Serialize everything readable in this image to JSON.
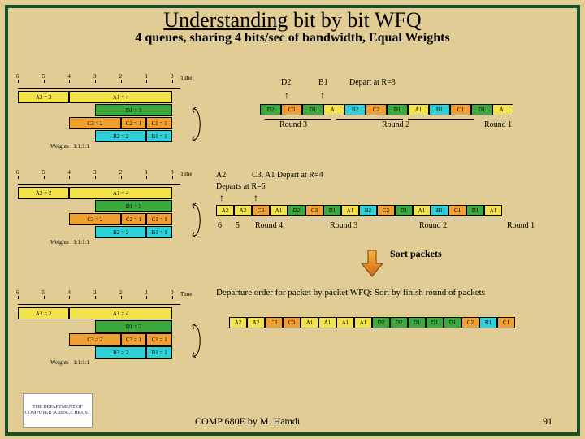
{
  "title_prefix": "Understanding",
  "title_rest": " bit by bit WFQ",
  "subtitle": "4 queues, sharing 4 bits/sec of bandwidth, Equal Weights",
  "time": "Time",
  "ticks": [
    "6",
    "5",
    "4",
    "3",
    "2",
    "1",
    "0"
  ],
  "pkt": {
    "A2": "A2 = 2",
    "A1": "A1 = 4",
    "D1": "D1 = 3",
    "C3": "C3 = 2",
    "C2": "C2 = 1",
    "C1": "C1 = 1",
    "B2": "B2 = 2",
    "B1": "B1 = 1"
  },
  "weights": "Weights : 1:1:1:1",
  "top": {
    "d2": "D2,",
    "b1": "B1",
    "depart": "Depart at R=3",
    "round3": "Round 3",
    "round2": "Round 2",
    "round1": "Round 1",
    "cells": [
      "D2",
      "C3",
      "D1",
      "A1",
      "B2",
      "C2",
      "D1",
      "A1",
      "B1",
      "C1",
      "D1",
      "A1"
    ]
  },
  "mid": {
    "line1a": "A2",
    "line1b": "C3, A1 Depart at R=4",
    "line2": "Departs at R=6",
    "round4": "Round 4,",
    "round3": "Round 3",
    "round2": "Round 2",
    "round1": "Round 1",
    "n6": "6",
    "n5": "5",
    "cells": [
      "A2",
      "A2",
      "C3",
      "A1",
      "D2",
      "C3",
      "D1",
      "A1",
      "B2",
      "C2",
      "D1",
      "A1",
      "B1",
      "C1",
      "D1",
      "A1"
    ]
  },
  "sort": "Sort packets",
  "dep_text": "Departure order for packet by packet WFQ: Sort by finish round of packets",
  "bot": {
    "cells": [
      "A2",
      "A2",
      "C3",
      "C3",
      "A1",
      "A1",
      "A1",
      "A1",
      "D2",
      "D2",
      "D1",
      "D1",
      "D1",
      "C2",
      "B1",
      "C1"
    ]
  },
  "footer": "COMP 680E by M. Hamdi",
  "page": "91",
  "logo": "THE DEPARTMENT OF COMPUTER SCIENCE HKUST"
}
